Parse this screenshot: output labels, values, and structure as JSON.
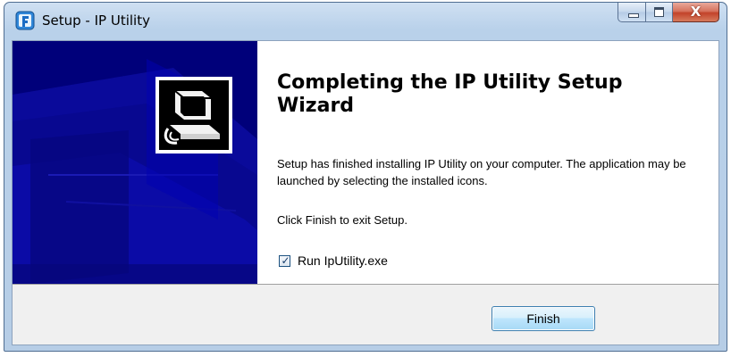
{
  "window": {
    "title": "Setup - IP Utility",
    "icon": "setup-app-icon",
    "controls": [
      "minimize-icon",
      "maximize-icon",
      "close-icon"
    ],
    "close_glyph": "X"
  },
  "wizard": {
    "heading": "Completing the IP Utility Setup Wizard",
    "body": "Setup has finished installing IP Utility on your computer. The application may be launched by selecting the installed icons.",
    "instruction": "Click Finish to exit Setup.",
    "run_checkbox": {
      "label": "Run IpUtility.exe",
      "checked": true,
      "check_glyph": "✓"
    },
    "finish_button": "Finish"
  },
  "colors": {
    "banner": "#00007a",
    "titlebar": "#b9d1ea",
    "close_button": "#c3432a",
    "footer": "#f0f0f0"
  }
}
